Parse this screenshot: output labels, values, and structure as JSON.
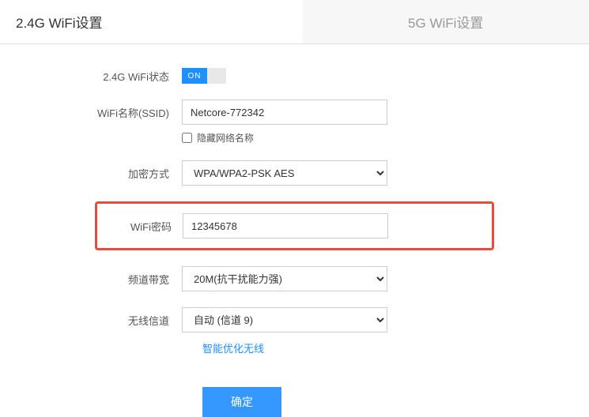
{
  "tabs": {
    "tab_24g": "2.4G WiFi设置",
    "tab_5g": "5G WiFi设置"
  },
  "labels": {
    "wifi_status": "2.4G WiFi状态",
    "ssid": "WiFi名称(SSID)",
    "hide_ssid": "隐藏网络名称",
    "encryption": "加密方式",
    "password": "WiFi密码",
    "bandwidth": "频道带宽",
    "channel": "无线信道"
  },
  "values": {
    "toggle_state": "ON",
    "ssid_value": "Netcore-772342",
    "encryption_value": "WPA/WPA2-PSK AES",
    "password_value": "12345678",
    "bandwidth_value": "20M(抗干扰能力强)",
    "channel_value": "自动 (信道 9)"
  },
  "link": {
    "optimize": "智能优化无线"
  },
  "buttons": {
    "submit": "确定"
  },
  "colors": {
    "accent": "#1e90ff",
    "highlight": "#e74c3c"
  }
}
